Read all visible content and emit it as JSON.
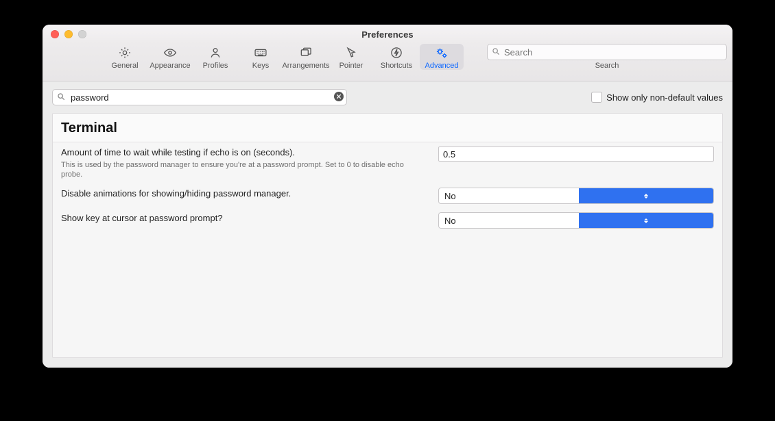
{
  "window": {
    "title": "Preferences"
  },
  "toolbar": {
    "items": [
      {
        "id": "general",
        "label": "General"
      },
      {
        "id": "appearance",
        "label": "Appearance"
      },
      {
        "id": "profiles",
        "label": "Profiles"
      },
      {
        "id": "keys",
        "label": "Keys"
      },
      {
        "id": "arrangements",
        "label": "Arrangements"
      },
      {
        "id": "pointer",
        "label": "Pointer"
      },
      {
        "id": "shortcuts",
        "label": "Shortcuts"
      },
      {
        "id": "advanced",
        "label": "Advanced"
      }
    ],
    "active_id": "advanced",
    "search": {
      "placeholder": "Search",
      "label": "Search"
    }
  },
  "filter": {
    "value": "password",
    "nondefault": {
      "label": "Show only non-default values",
      "checked": false
    }
  },
  "section": {
    "title": "Terminal"
  },
  "settings": [
    {
      "key": "echo_wait_seconds",
      "label": "Amount of time to wait while testing if echo is on (seconds).",
      "hint": "This is used by the password manager to ensure you're at a password prompt. Set to 0 to disable echo probe.",
      "type": "text",
      "value": "0.5"
    },
    {
      "key": "disable_pm_animations",
      "label": "Disable animations for showing/hiding password manager.",
      "type": "select",
      "value": "No"
    },
    {
      "key": "show_key_at_cursor",
      "label": "Show key at cursor at password prompt?",
      "type": "select",
      "value": "No"
    }
  ]
}
